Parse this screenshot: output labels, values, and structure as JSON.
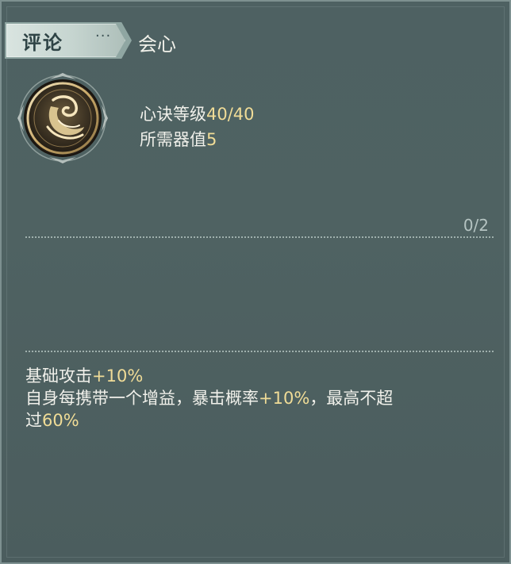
{
  "header": {
    "tab_label": "评论",
    "tab_dots": "···",
    "skill_name": "会心"
  },
  "icon": {
    "name": "crane-emblem-icon"
  },
  "stats": {
    "level_label": "心诀等级",
    "level_value": "40/40",
    "cost_label": "所需器值",
    "cost_value": "5"
  },
  "slots": {
    "count": "0/2"
  },
  "description": {
    "line1_prefix": "基础攻击",
    "line1_value": "+10%",
    "line2_prefix": "自身每携带一个增益，暴击概率",
    "line2_value": "+10%",
    "line2_suffix": "，最高不超",
    "line3_prefix": "过",
    "line3_value": "60%"
  },
  "colors": {
    "panel_bg": "#4f6262",
    "highlight_gold": "#f0dc97",
    "text_light": "#f0f0ea",
    "tab_bg": "#d9e4e0"
  }
}
